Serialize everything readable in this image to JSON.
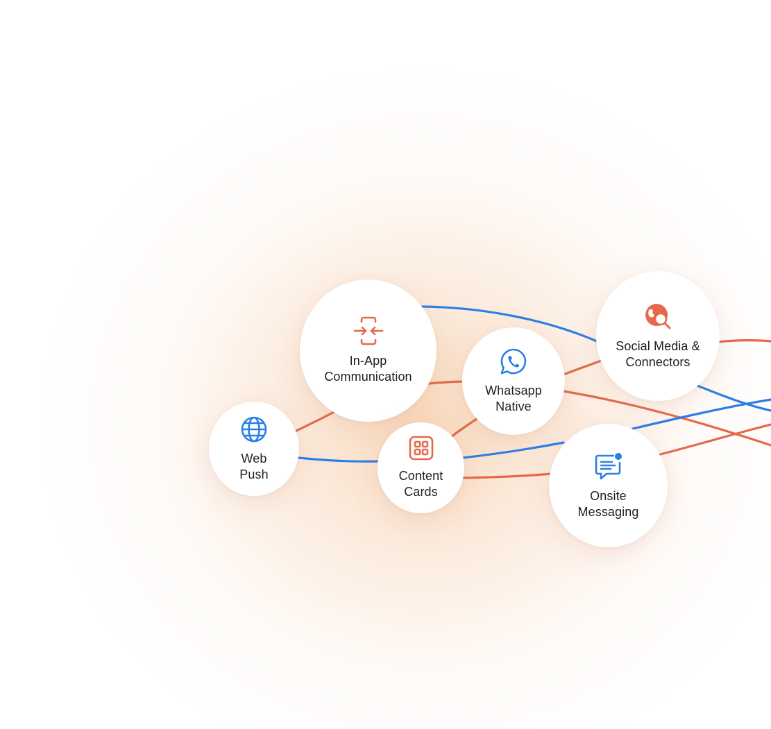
{
  "colors": {
    "blue": "#2a7fe6",
    "orange": "#e4694c",
    "text": "#1f1f24"
  },
  "nodes": {
    "web_push": {
      "label": "Web\nPush",
      "icon": "globe-icon",
      "color": "#2a7fe6"
    },
    "in_app": {
      "label": "In-App\nCommunication",
      "icon": "compress-arrows-icon",
      "color": "#e4694c"
    },
    "content_cards": {
      "label": "Content\nCards",
      "icon": "grid-cards-icon",
      "color": "#e4694c"
    },
    "whatsapp": {
      "label": "Whatsapp\nNative",
      "icon": "whatsapp-icon",
      "color": "#2a7fe6"
    },
    "social_media": {
      "label": "Social Media &\nConnectors",
      "icon": "globe-search-icon",
      "color": "#e4694c"
    },
    "onsite": {
      "label": "Onsite\nMessaging",
      "icon": "chat-notification-icon",
      "color": "#2a7fe6"
    }
  }
}
